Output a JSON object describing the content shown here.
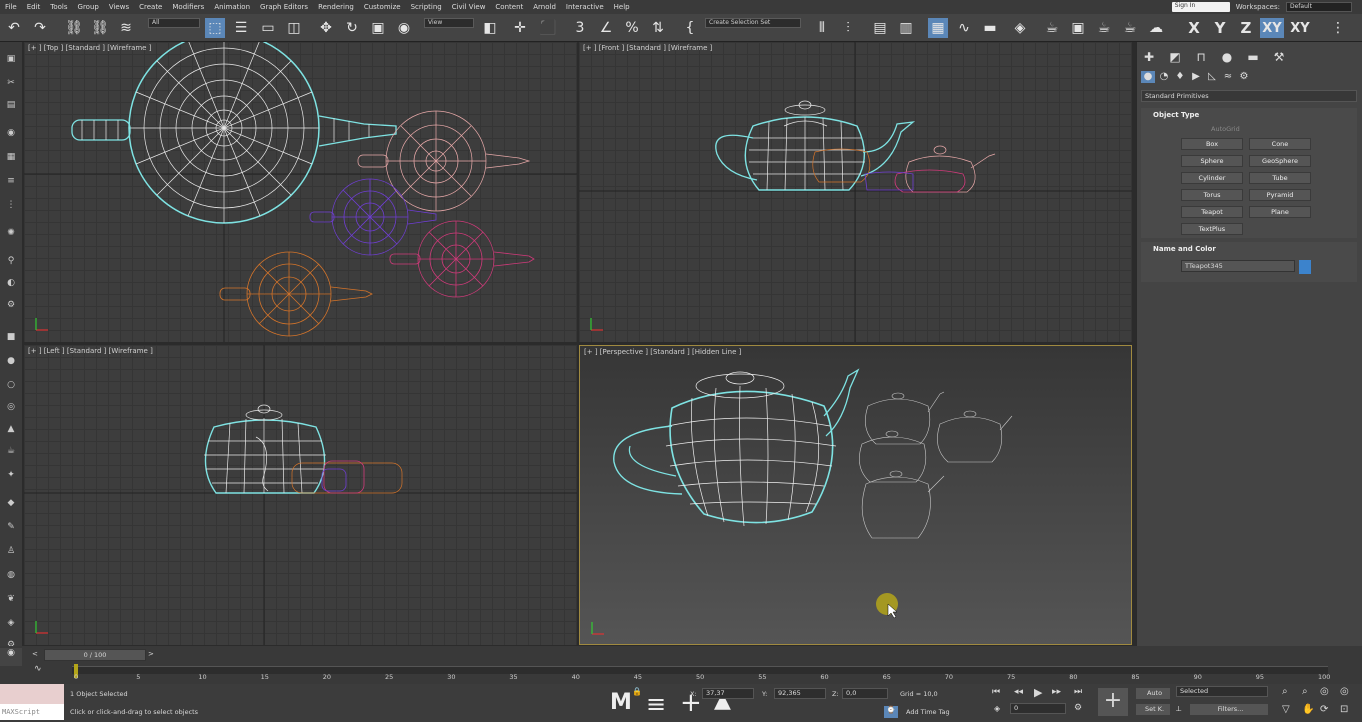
{
  "menu": [
    "File",
    "Edit",
    "Tools",
    "Group",
    "Views",
    "Create",
    "Modifiers",
    "Animation",
    "Graph Editors",
    "Rendering",
    "Customize",
    "Scripting",
    "Civil View",
    "Content",
    "Arnold",
    "Interactive",
    "Help"
  ],
  "signin": "Sign In",
  "workspace": {
    "label": "Workspaces:",
    "value": "Default"
  },
  "toolbar": {
    "selection_filter": "All",
    "ref_coord": "View",
    "selection_set": "Create Selection Set",
    "axes": [
      "X",
      "Y",
      "Z",
      "XY",
      "XY"
    ]
  },
  "viewports": {
    "top": "[+ ] [Top ] [Standard ] [Wireframe ]",
    "front": "[+ ] [Front ] [Standard ] [Wireframe ]",
    "left": "[+ ] [Left ] [Standard ] [Wireframe ]",
    "persp": "[+ ] [Perspective ] [Standard ] [Hidden Line ]"
  },
  "command_panel": {
    "category": "Standard Primitives",
    "object_type_title": "Object Type",
    "autogrid": "AutoGrid",
    "buttons": [
      "Box",
      "Cone",
      "Sphere",
      "GeoSphere",
      "Cylinder",
      "Tube",
      "Torus",
      "Pyramid",
      "Teapot",
      "Plane",
      "TextPlus"
    ],
    "name_color_title": "Name and Color",
    "object_name": "TTeapot345",
    "object_color": "#3c83cc"
  },
  "timeline": {
    "frame_display": "0 / 100",
    "ticks": [
      "0",
      "5",
      "10",
      "15",
      "20",
      "25",
      "30",
      "35",
      "40",
      "45",
      "50",
      "55",
      "60",
      "65",
      "70",
      "75",
      "80",
      "85",
      "90",
      "95",
      "100"
    ]
  },
  "status": {
    "maxscript": "MAXScript",
    "selected": "1 Object Selected",
    "prompt": "Click or click-and-drag to select objects",
    "x_label": "X:",
    "x_val": "37,37",
    "y_label": "Y:",
    "y_val": "92,365",
    "z_label": "Z:",
    "z_val": "0,0",
    "grid": "Grid = 10,0",
    "add_time_tag": "Add Time Tag",
    "auto": "Auto",
    "setk": "Set K.",
    "key_mode": "Selected",
    "filters": "Filters...",
    "frame": "0"
  }
}
